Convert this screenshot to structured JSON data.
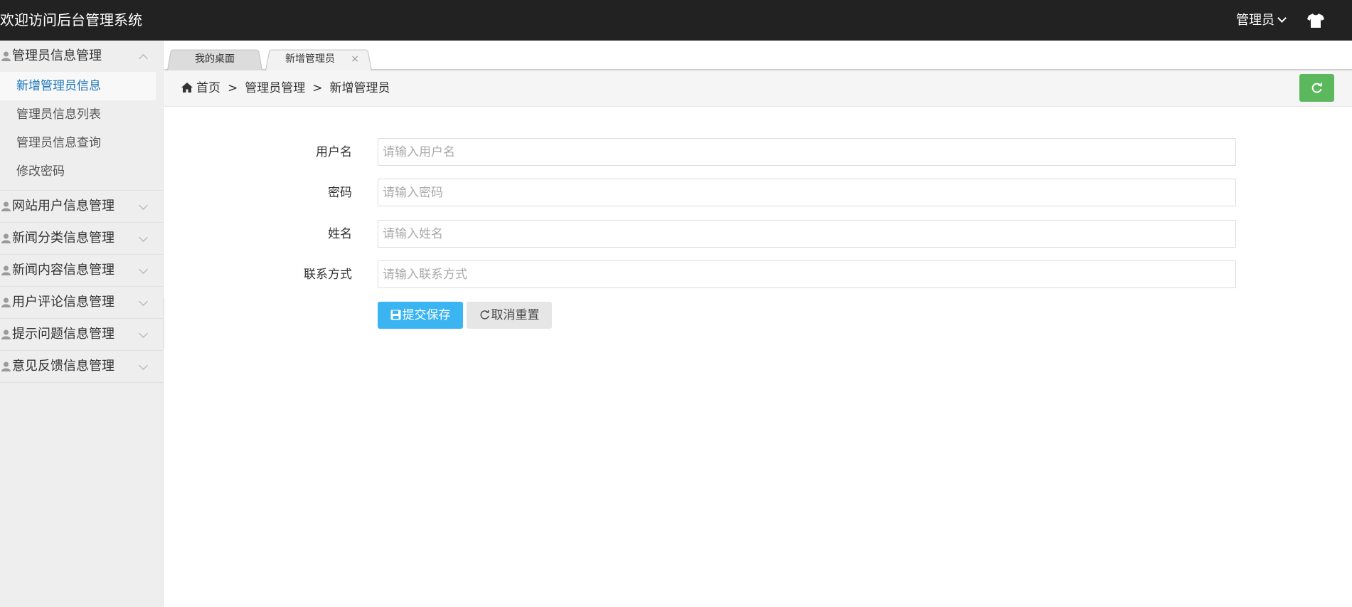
{
  "header": {
    "title": "欢迎访问后台管理系统",
    "user_label": "管理员",
    "theme_icon": "tshirt-icon"
  },
  "sidebar": {
    "groups": [
      {
        "label": "管理员信息管理",
        "expanded": true,
        "items": [
          "新增管理员信息",
          "管理员信息列表",
          "管理员信息查询",
          "修改密码"
        ]
      },
      {
        "label": "网站用户信息管理",
        "expanded": false
      },
      {
        "label": "新闻分类信息管理",
        "expanded": false
      },
      {
        "label": "新闻内容信息管理",
        "expanded": false
      },
      {
        "label": "用户评论信息管理",
        "expanded": false
      },
      {
        "label": "提示问题信息管理",
        "expanded": false
      },
      {
        "label": "意见反馈信息管理",
        "expanded": false
      }
    ],
    "active_item": "新增管理员信息"
  },
  "tabs": [
    {
      "label": "我的桌面",
      "active": false
    },
    {
      "label": "新增管理员",
      "active": true,
      "close": "×"
    }
  ],
  "breadcrumb": {
    "home": "首页",
    "separator": ">",
    "level1": "管理员管理",
    "level2": "新增管理员"
  },
  "form": {
    "fields": [
      {
        "label": "用户名",
        "placeholder": "请输入用户名",
        "value": ""
      },
      {
        "label": "密码",
        "placeholder": "请输入密码",
        "value": ""
      },
      {
        "label": "姓名",
        "placeholder": "请输入姓名",
        "value": ""
      },
      {
        "label": "联系方式",
        "placeholder": "请输入联系方式",
        "value": ""
      }
    ],
    "submit_label": "提交保存",
    "reset_label": "取消重置"
  },
  "colors": {
    "header_bg": "#222222",
    "sidebar_bg": "#eeeeee",
    "active_link": "#1a75bb",
    "primary_button": "#3bb4f2",
    "refresh_button": "#5cb85c"
  }
}
